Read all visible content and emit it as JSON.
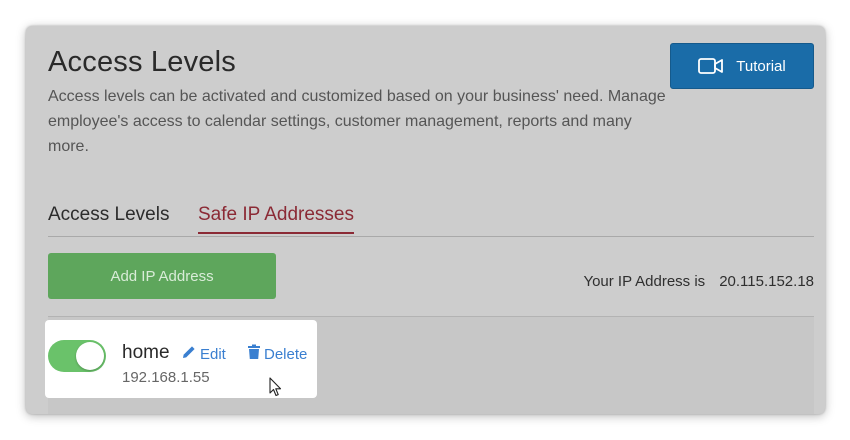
{
  "header": {
    "title": "Access Levels",
    "description": "Access levels can be activated and customized based on your business' need. Manage employee's access to calendar settings, customer management, reports and many more.",
    "tutorial_label": "Tutorial",
    "tutorial_icon": "video-camera-icon"
  },
  "tabs": [
    {
      "label": "Access Levels",
      "active": false
    },
    {
      "label": "Safe IP Addresses",
      "active": true
    }
  ],
  "toolbar": {
    "add_ip_label": "Add IP Address",
    "your_ip_label": "Your IP Address is",
    "your_ip_value": "20.115.152.18"
  },
  "ip_list": [
    {
      "name": "home",
      "address": "192.168.1.55",
      "enabled": true,
      "edit_label": "Edit",
      "delete_label": "Delete",
      "edit_icon": "pencil-icon",
      "delete_icon": "trash-icon"
    }
  ],
  "colors": {
    "tutorial_button": "#1a6ca8",
    "add_button": "#5ea65c",
    "active_tab": "#8b2a35",
    "toggle_on": "#6ac26a",
    "link": "#3a7fd0"
  }
}
